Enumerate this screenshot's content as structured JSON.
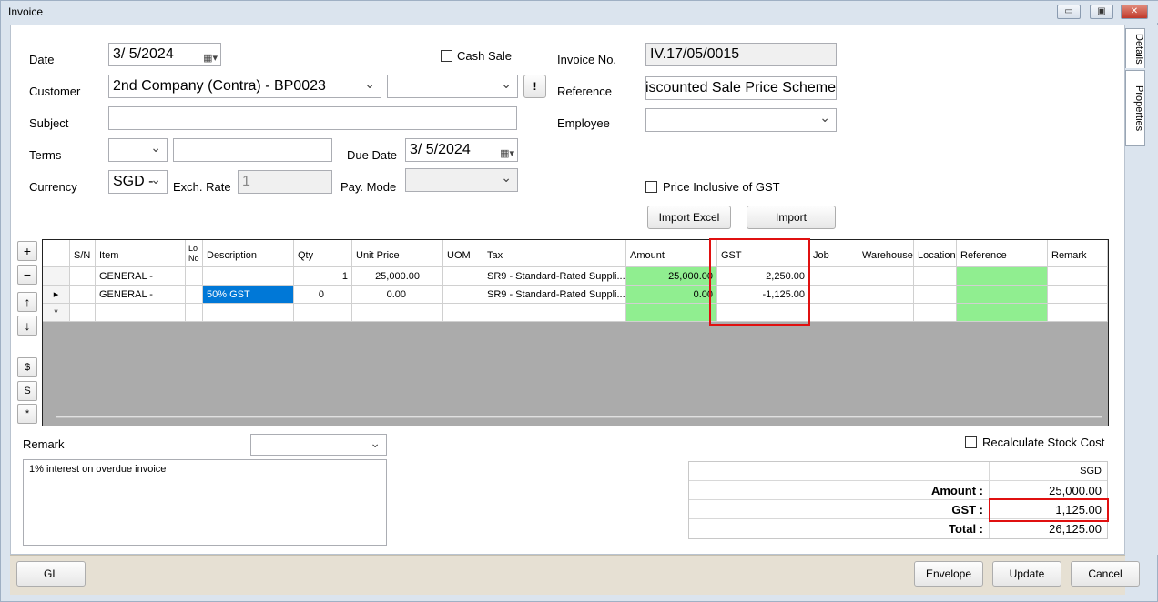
{
  "window": {
    "title": "Invoice",
    "minimize": "▭",
    "restore": "▣",
    "close": "✕"
  },
  "sidetabs": {
    "details": "Details",
    "properties": "Properties"
  },
  "form": {
    "date_label": "Date",
    "date_value": "3/  5/2024",
    "cash_sale_label": "Cash Sale",
    "invoice_no_label": "Invoice No.",
    "invoice_no_value": "IV.17/05/0015",
    "customer_label": "Customer",
    "customer_value": "2nd Company (Contra) - BP0023",
    "customer_alert": "!",
    "reference_label": "Reference",
    "reference_value": "Discounted Sale Price Scheme",
    "subject_label": "Subject",
    "subject_value": "",
    "employee_label": "Employee",
    "employee_value": "",
    "terms_label": "Terms",
    "terms_value": "",
    "due_date_label": "Due Date",
    "due_date_value": "3/  5/2024",
    "currency_label": "Currency",
    "currency_value": "SGD -",
    "exch_rate_label": "Exch. Rate",
    "exch_rate_value": "1",
    "pay_mode_label": "Pay. Mode",
    "pay_mode_value": "",
    "price_incl_gst_label": "Price Inclusive of GST",
    "import_excel_label": "Import Excel",
    "import_label": "Import"
  },
  "grid": {
    "columns": [
      "S/N",
      "Item",
      "Lo No",
      "Description",
      "Qty",
      "Unit Price",
      "UOM",
      "Tax",
      "Amount",
      "GST",
      "Job",
      "Warehouse",
      "Location",
      "Reference",
      "Remark"
    ],
    "rows": [
      {
        "indicator": "",
        "sn": "",
        "item": "GENERAL -",
        "lo": "",
        "description": "",
        "qty": "1",
        "unit_price": "25,000.00",
        "uom": "",
        "tax": "SR9 - Standard-Rated Suppli...",
        "amount": "25,000.00",
        "gst": "2,250.00"
      },
      {
        "indicator": "▸",
        "sn": "",
        "item": "GENERAL -",
        "lo": "",
        "description": "50% GST",
        "qty": "0",
        "unit_price": "0.00",
        "uom": "",
        "tax": "SR9 - Standard-Rated Suppli...",
        "amount": "0.00",
        "gst": "-1,125.00"
      },
      {
        "indicator": "*",
        "sn": "",
        "item": "",
        "lo": "",
        "description": "",
        "qty": "",
        "unit_price": "",
        "uom": "",
        "tax": "",
        "amount": "",
        "gst": ""
      }
    ]
  },
  "side_buttons": {
    "add": "+",
    "remove": "−",
    "up": "↑",
    "down": "↓",
    "dollar": "$",
    "s": "S",
    "star": "*"
  },
  "remark": {
    "label": "Remark",
    "text": "1% interest on overdue invoice",
    "dropdown_value": ""
  },
  "recalc_label": "Recalculate Stock Cost",
  "totals": {
    "currency": "SGD",
    "amount_label": "Amount :",
    "amount_value": "25,000.00",
    "gst_label": "GST :",
    "gst_value": "1,125.00",
    "total_label": "Total :",
    "total_value": "26,125.00"
  },
  "footer": {
    "gl_label": "GL",
    "envelope_label": "Envelope",
    "update_label": "Update",
    "cancel_label": "Cancel"
  },
  "colors": {
    "highlight": "#e01010",
    "green_cell": "#90ee90",
    "selection": "#0078d7"
  }
}
